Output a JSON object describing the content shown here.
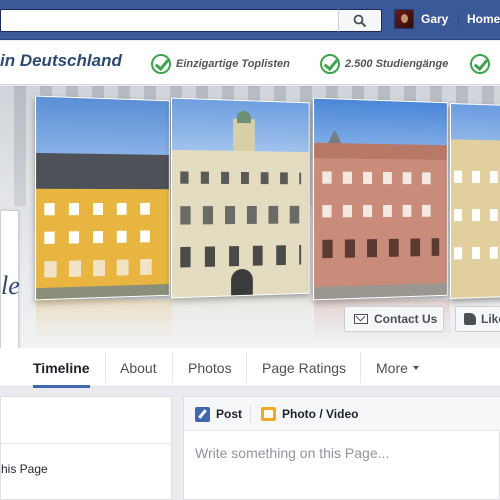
{
  "topbar": {
    "search_placeholder": "",
    "user_name": "Gary",
    "home_label": "Home"
  },
  "banner": {
    "brand": "in Deutschland",
    "features": [
      "Einzigartige Toplisten",
      "2.500 Studiengänge",
      ""
    ]
  },
  "cover": {
    "contact_label": "Contact Us",
    "like_label": "Like"
  },
  "tabs": {
    "timeline": "Timeline",
    "about": "About",
    "photos": "Photos",
    "ratings": "Page Ratings",
    "more": "More"
  },
  "left_card": {
    "text": "his Page"
  },
  "composer": {
    "post_label": "Post",
    "photo_label": "Photo / Video",
    "placeholder": "Write something on this Page..."
  }
}
